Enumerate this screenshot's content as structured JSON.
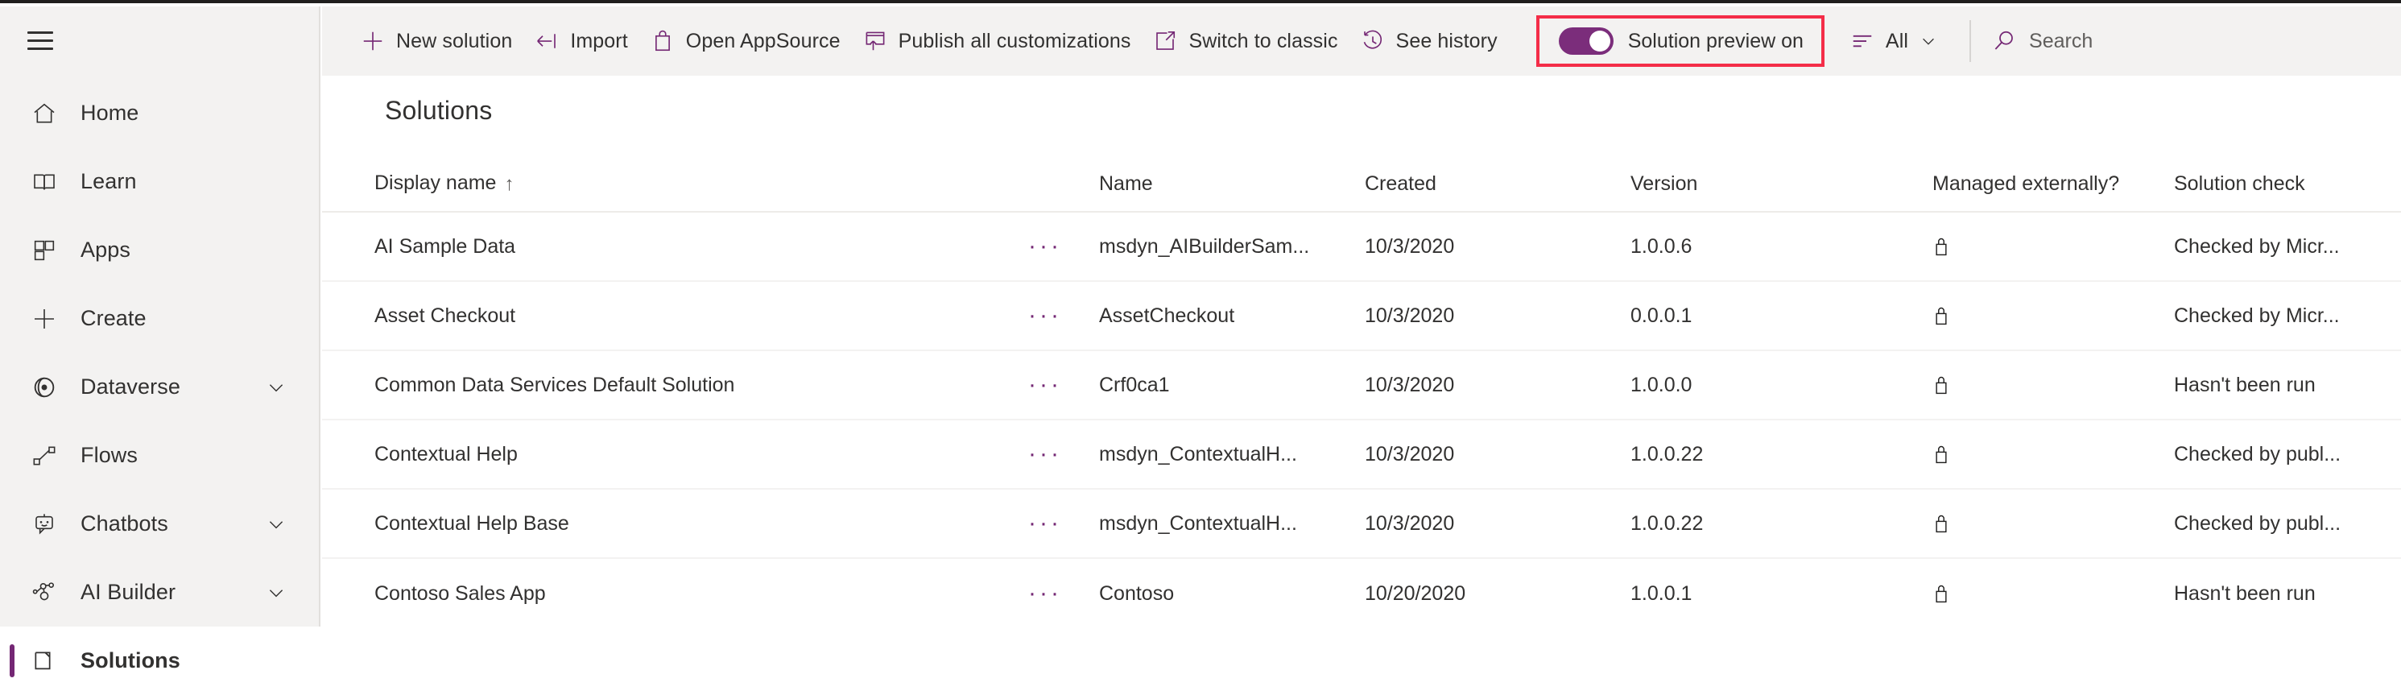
{
  "sidebar": {
    "menu_icon": "hamburger-icon",
    "items": [
      {
        "label": "Home",
        "icon": "home-icon",
        "chevron": false,
        "selected": false
      },
      {
        "label": "Learn",
        "icon": "book-icon",
        "chevron": false,
        "selected": false
      },
      {
        "label": "Apps",
        "icon": "apps-grid-icon",
        "chevron": false,
        "selected": false
      },
      {
        "label": "Create",
        "icon": "plus-icon",
        "chevron": false,
        "selected": false
      },
      {
        "label": "Dataverse",
        "icon": "dataverse-icon",
        "chevron": true,
        "selected": false
      },
      {
        "label": "Flows",
        "icon": "flow-icon",
        "chevron": false,
        "selected": false
      },
      {
        "label": "Chatbots",
        "icon": "chatbot-icon",
        "chevron": true,
        "selected": false
      },
      {
        "label": "AI Builder",
        "icon": "ai-builder-icon",
        "chevron": true,
        "selected": false
      },
      {
        "label": "Solutions",
        "icon": "solutions-icon",
        "chevron": false,
        "selected": true
      }
    ]
  },
  "command_bar": {
    "buttons": [
      {
        "label": "New solution",
        "icon": "plus-icon"
      },
      {
        "label": "Import",
        "icon": "import-arrow-icon"
      },
      {
        "label": "Open AppSource",
        "icon": "shopping-bag-icon"
      },
      {
        "label": "Publish all customizations",
        "icon": "publish-up-arrow-icon"
      },
      {
        "label": "Switch to classic",
        "icon": "external-link-icon"
      },
      {
        "label": "See history",
        "icon": "history-clock-icon"
      }
    ],
    "preview_toggle": {
      "label": "Solution preview on",
      "state": "on",
      "highlight_color": "#f42d48",
      "track_color": "#7b2d7b"
    },
    "filter": {
      "label": "All",
      "icon": "filter-lines-icon",
      "chevron": "chevron-down-icon"
    },
    "search": {
      "placeholder": "Search",
      "icon": "search-icon"
    }
  },
  "main": {
    "title": "Solutions",
    "table": {
      "columns": [
        {
          "key": "display_name",
          "label": "Display name",
          "sorted": "asc",
          "sort_glyph": "↑"
        },
        {
          "key": "name",
          "label": "Name"
        },
        {
          "key": "created",
          "label": "Created"
        },
        {
          "key": "version",
          "label": "Version"
        },
        {
          "key": "managed",
          "label": "Managed externally?"
        },
        {
          "key": "solution_check",
          "label": "Solution check"
        }
      ],
      "row_menu_glyph": "···",
      "rows": [
        {
          "display_name": "AI Sample Data",
          "name": "msdyn_AIBuilderSam...",
          "created": "10/3/2020",
          "version": "1.0.0.6",
          "managed": "lock-icon",
          "solution_check": "Checked by Micr..."
        },
        {
          "display_name": "Asset Checkout",
          "name": "AssetCheckout",
          "created": "10/3/2020",
          "version": "0.0.0.1",
          "managed": "lock-icon",
          "solution_check": "Checked by Micr..."
        },
        {
          "display_name": "Common Data Services Default Solution",
          "name": "Crf0ca1",
          "created": "10/3/2020",
          "version": "1.0.0.0",
          "managed": "lock-icon",
          "solution_check": "Hasn't been run"
        },
        {
          "display_name": "Contextual Help",
          "name": "msdyn_ContextualH...",
          "created": "10/3/2020",
          "version": "1.0.0.22",
          "managed": "lock-icon",
          "solution_check": "Checked by publ..."
        },
        {
          "display_name": "Contextual Help Base",
          "name": "msdyn_ContextualH...",
          "created": "10/3/2020",
          "version": "1.0.0.22",
          "managed": "lock-icon",
          "solution_check": "Checked by publ..."
        },
        {
          "display_name": "Contoso Sales App",
          "name": "Contoso",
          "created": "10/20/2020",
          "version": "1.0.0.1",
          "managed": "lock-icon",
          "solution_check": "Hasn't been run"
        }
      ]
    }
  },
  "colors": {
    "brand_purple": "#742774",
    "toggle_purple": "#7b2d7b",
    "annotation_red": "#f42d48",
    "sidebar_bg": "#f3f2f1",
    "text": "#323130"
  }
}
